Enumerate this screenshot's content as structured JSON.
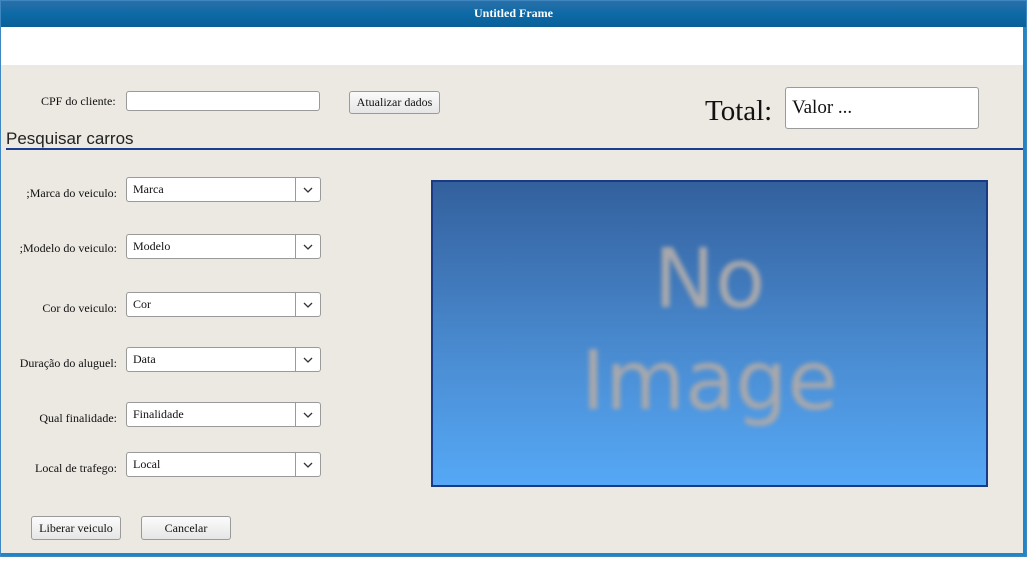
{
  "window": {
    "title": "Untitled Frame"
  },
  "cpf": {
    "label": "CPF do cliente:",
    "value": ""
  },
  "update_button": "Atualizar dados",
  "total": {
    "label": "Total:",
    "value": "Valor ..."
  },
  "section_title": "Pesquisar carros",
  "fields": [
    {
      "label": ";Marca do veiculo:",
      "value": "Marca"
    },
    {
      "label": ";Modelo do veiculo:",
      "value": "Modelo"
    },
    {
      "label": "Cor do veiculo:",
      "value": "Cor"
    },
    {
      "label": "Duração do aluguel:",
      "value": "Data"
    },
    {
      "label": "Qual finalidade:",
      "value": "Finalidade"
    },
    {
      "label": "Local de trafego:",
      "value": "Local"
    }
  ],
  "image_placeholder": {
    "line1": "No",
    "line2": "Image"
  },
  "buttons": {
    "release": "Liberar veiculo",
    "cancel": "Cancelar"
  },
  "colors": {
    "titlebar": "#0d6aa6",
    "section_line": "#1a3d8f",
    "image_gradient_top": "#33609d",
    "image_gradient_bottom": "#55a8f6"
  },
  "icons": {
    "dropdown": "chevron-down-icon"
  }
}
